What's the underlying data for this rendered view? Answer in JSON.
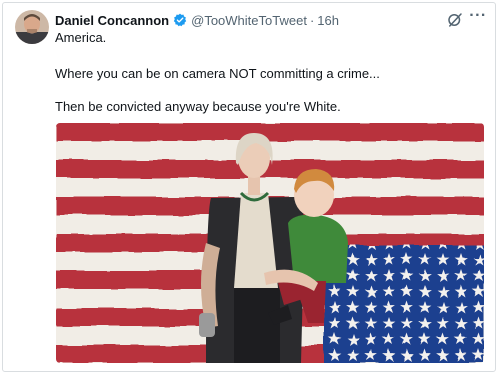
{
  "tweet": {
    "author_name": "Daniel Concannon",
    "handle": "@TooWhiteToTweet",
    "separator": "·",
    "time": "16h",
    "lines": [
      "America.",
      "Where you can be on camera NOT committing a crime...",
      "Then be convicted anyway because you're White."
    ],
    "more_glyph": "···"
  },
  "icons": {
    "verified": "verified-badge-icon",
    "grok": "grok-icon",
    "more": "more-options-icon"
  },
  "colors": {
    "verified": "#1d9bf0",
    "flag_red": "#b8323c",
    "flag_blue": "#1f3f8f",
    "text_secondary": "#536471"
  }
}
